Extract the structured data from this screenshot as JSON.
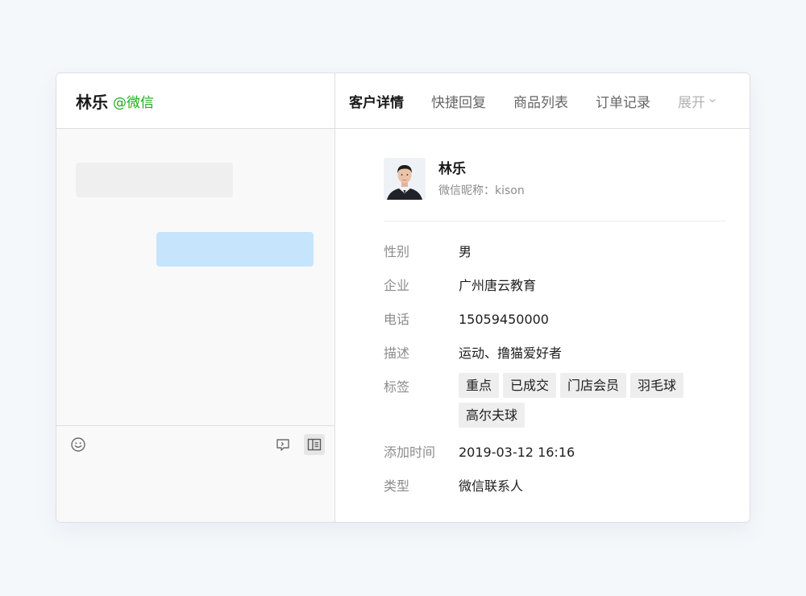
{
  "chat": {
    "contact_name": "林乐",
    "contact_source": "@微信"
  },
  "composer": {
    "icons": [
      "emoji-icon",
      "chat-quote-icon",
      "side-panel-icon"
    ]
  },
  "tabs": [
    {
      "label": "客户详情",
      "active": true
    },
    {
      "label": "快捷回复",
      "active": false
    },
    {
      "label": "商品列表",
      "active": false
    },
    {
      "label": "订单记录",
      "active": false
    }
  ],
  "tabs_more": {
    "label": "展开",
    "icon": "chevron-down-icon"
  },
  "customer": {
    "name": "林乐",
    "nickname": "微信昵称：kison",
    "fields": {
      "gender": {
        "label": "性别",
        "value": "男"
      },
      "company": {
        "label": "企业",
        "value": "广州唐云教育"
      },
      "phone": {
        "label": "电话",
        "value": "15059450000"
      },
      "description": {
        "label": "描述",
        "value": "运动、撸猫爱好者"
      },
      "tags": {
        "label": "标签",
        "values": [
          "重点",
          "已成交",
          "门店会员",
          "羽毛球",
          "高尔夫球"
        ]
      },
      "added_time": {
        "label": "添加时间",
        "value": "2019-03-12 16:16"
      },
      "type": {
        "label": "类型",
        "value": "微信联系人"
      }
    }
  },
  "colors": {
    "accent_green": "#1aad19",
    "outgoing_bubble": "#c6e5fd",
    "incoming_bubble": "#efefef",
    "background": "#f5f8fb"
  }
}
